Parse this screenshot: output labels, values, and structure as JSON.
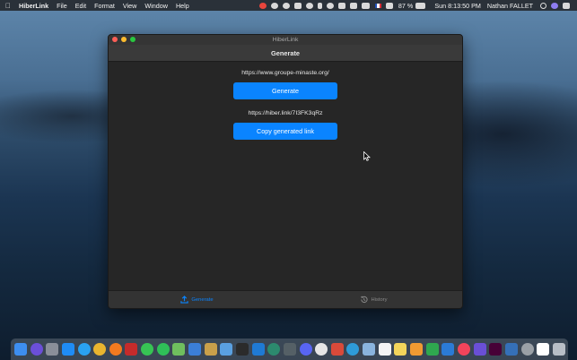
{
  "menubar": {
    "app_name": "HiberLink",
    "menus": [
      "File",
      "Edit",
      "Format",
      "View",
      "Window",
      "Help"
    ],
    "battery": "87 %",
    "datetime": "Sun 8:13:50 PM",
    "user": "Nathan FALLET"
  },
  "window": {
    "title": "HiberLink",
    "nav_title": "Generate",
    "input_url": "https://www.groupe-minaste.org/",
    "generate_label": "Generate",
    "generated_url": "https://hiber.link/7I3FK3qRz",
    "copy_label": "Copy generated link",
    "tabs": [
      {
        "label": "Generate",
        "icon": "upload-icon",
        "active": true
      },
      {
        "label": "History",
        "icon": "history-icon",
        "active": false
      }
    ]
  },
  "dock": {
    "items": [
      {
        "name": "finder-icon",
        "color": "#3d8ef0"
      },
      {
        "name": "siri-icon",
        "color": "#6b4fd8"
      },
      {
        "name": "launchpad-icon",
        "color": "#8a8f99"
      },
      {
        "name": "app-store-icon",
        "color": "#1f8cf5"
      },
      {
        "name": "safari-icon",
        "color": "#2aa2f2"
      },
      {
        "name": "chrome-icon",
        "color": "#e9b52f"
      },
      {
        "name": "firefox-icon",
        "color": "#f27a1f"
      },
      {
        "name": "filezilla-icon",
        "color": "#c52b2b"
      },
      {
        "name": "messages-icon",
        "color": "#37c454"
      },
      {
        "name": "facetime-icon",
        "color": "#2fbf58"
      },
      {
        "name": "maps-icon",
        "color": "#6fbf5e"
      },
      {
        "name": "xcode-icon",
        "color": "#3b7fd8"
      },
      {
        "name": "stack-icon",
        "color": "#c9a04a"
      },
      {
        "name": "proxyman-icon",
        "color": "#5aa0e0"
      },
      {
        "name": "terminal-icon",
        "color": "#2b2b2b"
      },
      {
        "name": "trello-icon",
        "color": "#1f7ad4"
      },
      {
        "name": "vpn-icon",
        "color": "#2c8a6e"
      },
      {
        "name": "robot-icon",
        "color": "#556066"
      },
      {
        "name": "discord-icon",
        "color": "#5865f2"
      },
      {
        "name": "slack-icon",
        "color": "#e6e6e6"
      },
      {
        "name": "taskheat-icon",
        "color": "#d84a3a"
      },
      {
        "name": "teams-icon",
        "color": "#2e9bd8"
      },
      {
        "name": "preview-icon",
        "color": "#8ab4dd"
      },
      {
        "name": "calendar-icon",
        "color": "#f4f4f4"
      },
      {
        "name": "notes-icon",
        "color": "#f3d55b"
      },
      {
        "name": "pages-icon",
        "color": "#f09a32"
      },
      {
        "name": "numbers-icon",
        "color": "#2fa84f"
      },
      {
        "name": "keynote-icon",
        "color": "#2b7bd6"
      },
      {
        "name": "music-icon",
        "color": "#f2445b"
      },
      {
        "name": "imovie-icon",
        "color": "#6a4fd6"
      },
      {
        "name": "adobe-xd-icon",
        "color": "#470137"
      },
      {
        "name": "virtualbox-icon",
        "color": "#3570b8"
      },
      {
        "name": "disk-utility-icon",
        "color": "#9aa0a6"
      },
      {
        "name": "hiberlink-icon",
        "color": "#ffffff"
      },
      {
        "name": "trash-icon",
        "color": "#b8bec6"
      }
    ]
  }
}
